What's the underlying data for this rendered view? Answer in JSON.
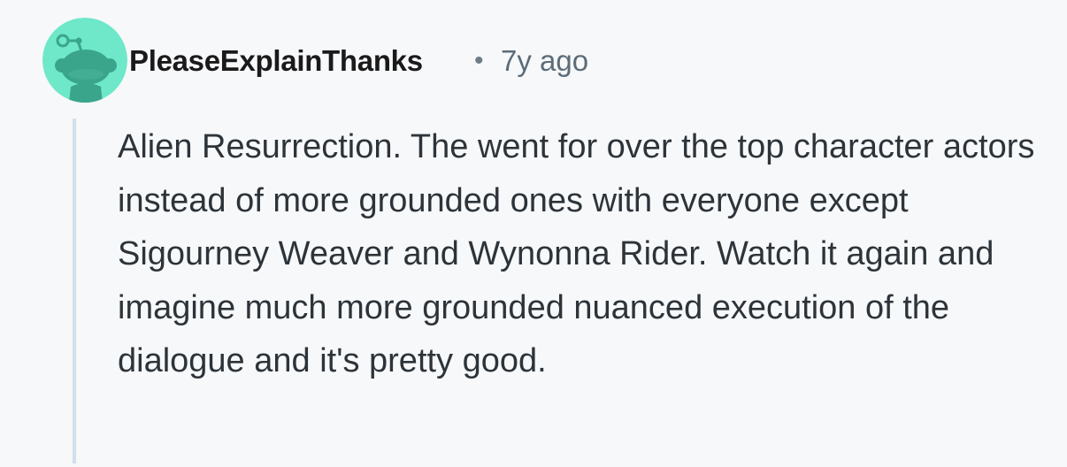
{
  "comment": {
    "username": "PleaseExplainThanks",
    "separator": "•",
    "age": "7y ago",
    "body": "Alien Resurrection. The went for over the top character actors instead of more grounded ones with everyone except Sigourney Weaver and Wynonna Rider. Watch it again and imagine much more grounded nuanced execution of the dialogue and it's pretty good."
  },
  "colors": {
    "avatar_background": "#6ee8c8",
    "avatar_figure": "#3aa58b",
    "thread_line": "#d3dfe9",
    "page_background": "#f7f8fa"
  },
  "icons": {
    "avatar": "snoo-avatar-icon"
  }
}
